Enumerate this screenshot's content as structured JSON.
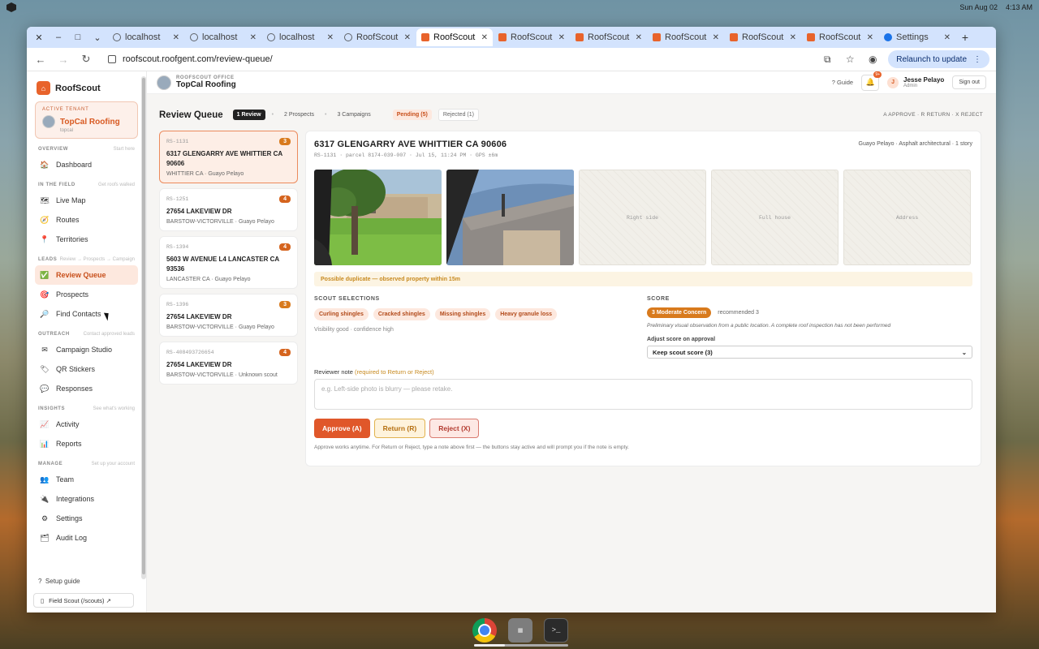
{
  "os": {
    "date": "Sun Aug 02",
    "time": "4:13 AM"
  },
  "tabs": [
    {
      "label": "localhost",
      "favicon": "globe-icon"
    },
    {
      "label": "localhost",
      "favicon": "globe-icon"
    },
    {
      "label": "localhost",
      "favicon": "globe-icon"
    },
    {
      "label": "RoofScout",
      "favicon": "globe-icon"
    },
    {
      "label": "RoofScout",
      "favicon": "roofscout-icon",
      "active": true
    },
    {
      "label": "RoofScout",
      "favicon": "roofscout-icon"
    },
    {
      "label": "RoofScout",
      "favicon": "roofscout-icon"
    },
    {
      "label": "RoofScout",
      "favicon": "roofscout-icon"
    },
    {
      "label": "RoofScout",
      "favicon": "roofscout-icon"
    },
    {
      "label": "RoofScout",
      "favicon": "roofscout-icon"
    },
    {
      "label": "Settings",
      "favicon": "gear-icon"
    }
  ],
  "toolbar": {
    "url": "roofscout.roofgent.com/review-queue/",
    "relaunch": "Relaunch to update"
  },
  "sidebar": {
    "brand": "RoofScout",
    "tenant": {
      "label": "ACTIVE TENANT",
      "name": "TopCal Roofing",
      "slug": "topcal"
    },
    "sections": [
      {
        "title": "OVERVIEW",
        "hint": "Start here",
        "items": [
          {
            "label": "Dashboard",
            "icon": "🏠"
          }
        ]
      },
      {
        "title": "IN THE FIELD",
        "hint": "Get roofs walked",
        "items": [
          {
            "label": "Live Map",
            "icon": "🗺"
          },
          {
            "label": "Routes",
            "icon": "🧭"
          },
          {
            "label": "Territories",
            "icon": "📍"
          }
        ]
      },
      {
        "title": "LEADS",
        "hint": "Review → Prospects → Campaign",
        "items": [
          {
            "label": "Review Queue",
            "icon": "✅",
            "active": true
          },
          {
            "label": "Prospects",
            "icon": "🎯"
          },
          {
            "label": "Find Contacts",
            "icon": "🔎"
          }
        ]
      },
      {
        "title": "OUTREACH",
        "hint": "Contact approved leads",
        "items": [
          {
            "label": "Campaign Studio",
            "icon": "✉"
          },
          {
            "label": "QR Stickers",
            "icon": "🏷"
          },
          {
            "label": "Responses",
            "icon": "💬"
          }
        ]
      },
      {
        "title": "INSIGHTS",
        "hint": "See what's working",
        "items": [
          {
            "label": "Activity",
            "icon": "📈"
          },
          {
            "label": "Reports",
            "icon": "📊"
          }
        ]
      },
      {
        "title": "MANAGE",
        "hint": "Set up your account",
        "items": [
          {
            "label": "Team",
            "icon": "👥"
          },
          {
            "label": "Integrations",
            "icon": "🔌"
          },
          {
            "label": "Settings",
            "icon": "⚙"
          },
          {
            "label": "Audit Log",
            "icon": "🗂"
          }
        ]
      }
    ],
    "setup": "Setup guide",
    "field_scout": "Field Scout (/scouts) ↗"
  },
  "topbar": {
    "office_label": "ROOFSCOUT OFFICE",
    "office_name": "TopCal Roofing",
    "guide": "Guide",
    "notif_count": "9+",
    "user_initial": "J",
    "user_name": "Jesse Pelayo",
    "user_role": "Admin",
    "signout": "Sign out"
  },
  "header": {
    "title": "Review Queue",
    "tab_review": "1 Review",
    "tab_prospects": "2 Prospects",
    "tab_campaigns": "3 Campaigns",
    "pending": "Pending (5)",
    "rejected": "Rejected (1)",
    "shortcuts": "A APPROVE · R RETURN · X REJECT"
  },
  "queue": [
    {
      "id": "RS-1131",
      "score": "3",
      "address": "6317 GLENGARRY AVE WHITTIER CA 90606",
      "sub": "WHITTIER CA · Guayo Pelayo",
      "active": true
    },
    {
      "id": "RS-1251",
      "score": "4",
      "address": "27654 LAKEVIEW DR",
      "sub": "BARSTOW-VICTORVILLE · Guayo Pelayo"
    },
    {
      "id": "RS-1394",
      "score": "4",
      "address": "5603 W AVENUE L4 LANCASTER CA 93536",
      "sub": "LANCASTER CA · Guayo Pelayo"
    },
    {
      "id": "RS-1396",
      "score": "3",
      "address": "27654 LAKEVIEW DR",
      "sub": "BARSTOW-VICTORVILLE · Guayo Pelayo"
    },
    {
      "id": "RS-408493726654",
      "score": "4",
      "address": "27654 LAKEVIEW DR",
      "sub": "BARSTOW-VICTORVILLE · Unknown scout"
    }
  ],
  "detail": {
    "address": "6317 GLENGARRY AVE WHITTIER CA 90606",
    "meta": "RS-1131 · parcel 8174-039-007 · Jul 15, 11:24 PM · GPS ±6m",
    "right": "Guayo Pelayo · Asphalt architectural · 1 story",
    "placeholders": [
      "Right side",
      "Full house",
      "Address"
    ],
    "duplicate": "Possible duplicate — observed property within 15m",
    "selections_label": "SCOUT SELECTIONS",
    "chips": [
      "Curling shingles",
      "Cracked shingles",
      "Missing shingles",
      "Heavy granule loss"
    ],
    "visibility": "Visibility good · confidence high",
    "score_label": "SCORE",
    "score_badge": "3  Moderate Concern",
    "recommended": "recommended 3",
    "prelim": "Preliminary visual observation from a public location. A complete roof inspection has not been performed",
    "adjust_label": "Adjust score on approval",
    "adjust_value": "Keep scout score (3)",
    "note_label": "Reviewer note",
    "note_req": "(required to Return or Reject)",
    "note_placeholder": "e.g. Left-side photo is blurry — please retake.",
    "approve": "Approve (A)",
    "return": "Return (R)",
    "reject": "Reject (X)",
    "footer": "Approve works anytime. For Return or Reject, type a note above first — the buttons stay active and will prompt you if the note is empty."
  },
  "colors": {
    "accent": "#e8632b",
    "score": "#d87a1d"
  }
}
